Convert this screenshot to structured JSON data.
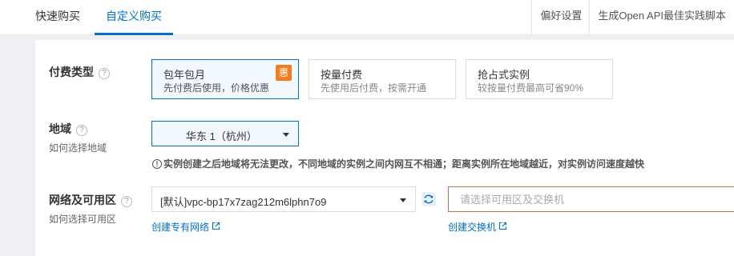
{
  "tabs": [
    {
      "label": "快速购买",
      "active": false
    },
    {
      "label": "自定义购买",
      "active": true
    }
  ],
  "header_links": [
    "偏好设置",
    "生成Open API最佳实践脚本"
  ],
  "billing": {
    "label": "付费类型",
    "options": [
      {
        "title": "包年包月",
        "subtitle": "先付费后使用，价格优惠",
        "badge": "惠",
        "selected": true
      },
      {
        "title": "按量付费",
        "subtitle": "先使用后付费，按需开通",
        "selected": false
      },
      {
        "title": "抢占式实例",
        "subtitle": "较按量付费最高可省90%",
        "selected": false
      }
    ]
  },
  "region": {
    "label": "地域",
    "help_text": "如何选择地域",
    "selected": "华东 1（杭州）",
    "notice": "实例创建之后地域将无法更改，不同地域的实例之间内网互不相通；距离实例所在地域越近，对实例访问速度越快"
  },
  "network": {
    "label": "网络及可用区",
    "help_text": "如何选择可用区",
    "vpc_value": "[默认]vpc-bp17x7zag212m6lphn7o9",
    "zone_placeholder": "请选择可用区及交换机",
    "create_vpc_link": "创建专有网络",
    "create_vswitch_link": "创建交换机"
  },
  "colors": {
    "accent": "#0070cc",
    "badge": "#f57b1e",
    "error_border": "#c86a5a"
  }
}
